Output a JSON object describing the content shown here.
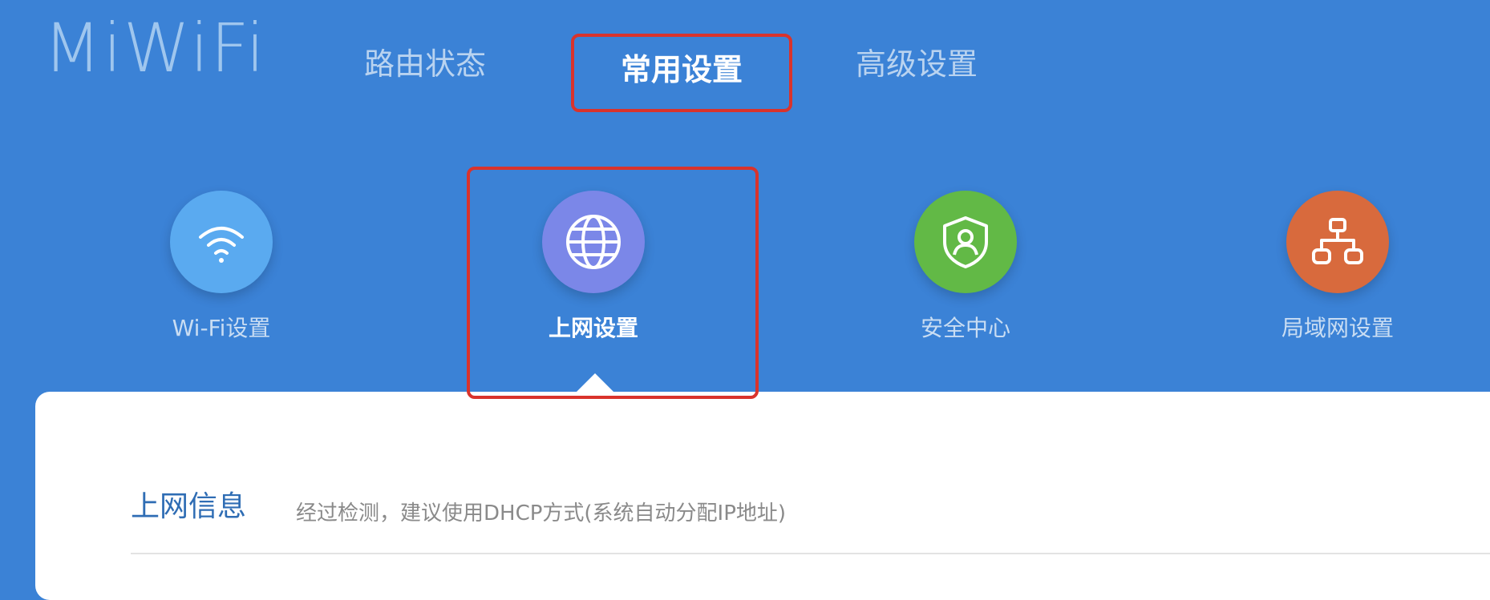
{
  "logo": {
    "text": "MiWiFi"
  },
  "nav": {
    "tabs": [
      {
        "label": "路由状态",
        "active": false
      },
      {
        "label": "常用设置",
        "active": true
      },
      {
        "label": "高级设置",
        "active": false
      }
    ]
  },
  "subnav": {
    "items": [
      {
        "label": "Wi-Fi设置",
        "icon": "wifi-icon",
        "color": "#5aaaf0",
        "active": false
      },
      {
        "label": "上网设置",
        "icon": "globe-icon",
        "color": "#7b87e8",
        "active": true
      },
      {
        "label": "安全中心",
        "icon": "shield-user-icon",
        "color": "#62b946",
        "active": false
      },
      {
        "label": "局域网设置",
        "icon": "network-icon",
        "color": "#d86a3d",
        "active": false
      }
    ]
  },
  "section": {
    "title": "上网信息",
    "description": "经过检测，建议使用DHCP方式(系统自动分配IP地址)"
  },
  "colors": {
    "background": "#3b82d6",
    "highlight": "#d9332c",
    "panel": "#ffffff"
  }
}
